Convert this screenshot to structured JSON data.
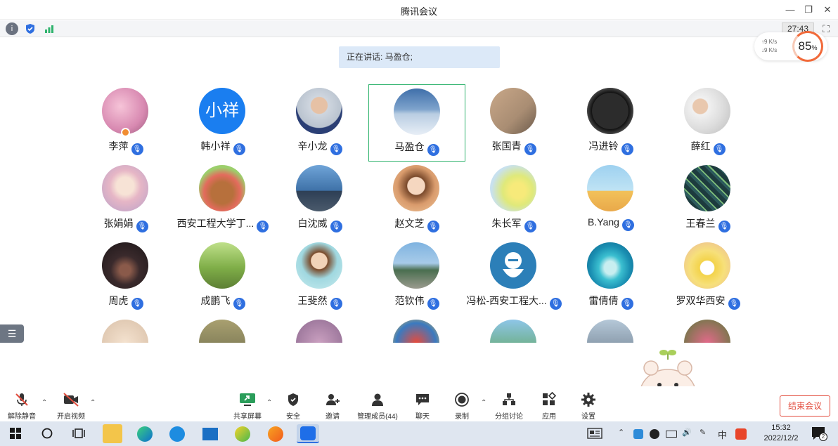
{
  "window": {
    "title": "腾讯会议"
  },
  "infobar": {
    "timer": "27:43"
  },
  "network": {
    "upload": "↑9  K/s",
    "download": "↓9  K/s",
    "percent": "85",
    "percent_unit": "%"
  },
  "speaking": {
    "text": "正在讲话: 马盈仓;"
  },
  "participants": [
    {
      "name": "李萍"
    },
    {
      "name": "韩小祥",
      "avatar_text": "小祥"
    },
    {
      "name": "辛小龙"
    },
    {
      "name": "马盈仓"
    },
    {
      "name": "张国青"
    },
    {
      "name": "冯进铃"
    },
    {
      "name": "薛红"
    },
    {
      "name": "张娟娟"
    },
    {
      "name": "西安工程大学丁..."
    },
    {
      "name": "白沈威"
    },
    {
      "name": "赵文芝"
    },
    {
      "name": "朱长军"
    },
    {
      "name": "B.Yang"
    },
    {
      "name": "王春兰"
    },
    {
      "name": "周虎"
    },
    {
      "name": "成鹏飞"
    },
    {
      "name": "王斐然"
    },
    {
      "name": "范钦伟"
    },
    {
      "name": "冯松-西安工程大..."
    },
    {
      "name": "雷倩倩"
    },
    {
      "name": "罗双华西安"
    }
  ],
  "toolbar": {
    "unmute": "解除静音",
    "video": "开启视频",
    "share": "共享屏幕",
    "security": "安全",
    "invite": "邀请",
    "members": "管理成员(44)",
    "chat": "聊天",
    "record": "录制",
    "breakout": "分组讨论",
    "apps": "应用",
    "settings": "设置",
    "end": "结束会议"
  },
  "taskbar": {
    "time": "15:32",
    "date": "2022/12/2",
    "ime": "中",
    "notification_count": "2"
  },
  "colors": {
    "mic_blue": "#2f6fe0",
    "active_green": "#2fb36d",
    "end_red": "#e24b3c"
  }
}
